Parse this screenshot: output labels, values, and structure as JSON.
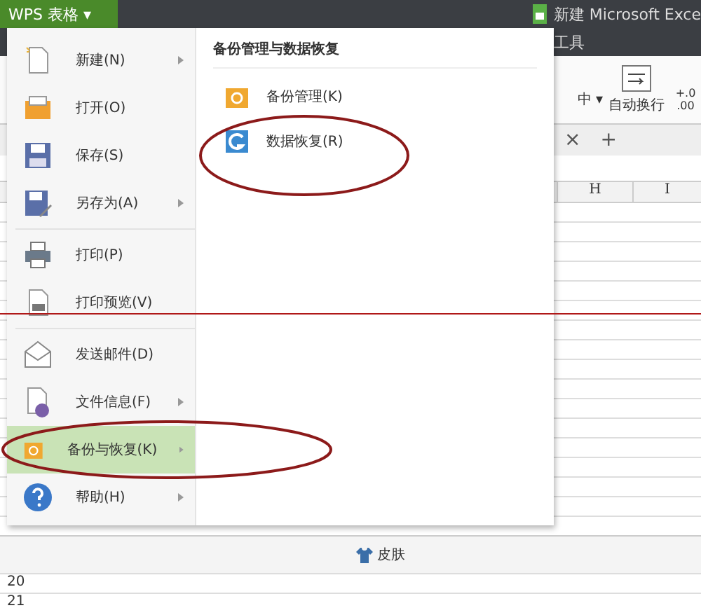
{
  "app_button": {
    "label": "WPS 表格",
    "caret": "▾"
  },
  "title": "新建 Microsoft Exce",
  "ribbon": {
    "tab": "工具",
    "buttons": [
      {
        "label": "中 ▾",
        "kind": "merge"
      },
      {
        "label": "自动换行",
        "kind": "wrap"
      },
      {
        "label": "+.0\n.00",
        "kind": "decimal"
      }
    ]
  },
  "sheet_tabs": {
    "close": "×",
    "add": "+"
  },
  "columns": [
    "H",
    "I"
  ],
  "rows": [
    "20",
    "21"
  ],
  "status": {
    "skin": "皮肤"
  },
  "menu": {
    "items": [
      {
        "label": "新建(N)",
        "submenu": true,
        "selected": false,
        "divider_after": false
      },
      {
        "label": "打开(O)",
        "submenu": false,
        "selected": false,
        "divider_after": false
      },
      {
        "label": "保存(S)",
        "submenu": false,
        "selected": false,
        "divider_after": false
      },
      {
        "label": "另存为(A)",
        "submenu": true,
        "selected": false,
        "divider_after": true
      },
      {
        "label": "打印(P)",
        "submenu": false,
        "selected": false,
        "divider_after": false
      },
      {
        "label": "打印预览(V)",
        "submenu": false,
        "selected": false,
        "divider_after": true
      },
      {
        "label": "发送邮件(D)",
        "submenu": false,
        "selected": false,
        "divider_after": false
      },
      {
        "label": "文件信息(F)",
        "submenu": true,
        "selected": false,
        "divider_after": false
      },
      {
        "label": "备份与恢复(K)",
        "submenu": true,
        "selected": true,
        "divider_after": false
      },
      {
        "label": "帮助(H)",
        "submenu": true,
        "selected": false,
        "divider_after": false
      }
    ],
    "submenu": {
      "title": "备份管理与数据恢复",
      "items": [
        {
          "label": "备份管理(K)"
        },
        {
          "label": "数据恢复(R)"
        }
      ]
    }
  }
}
